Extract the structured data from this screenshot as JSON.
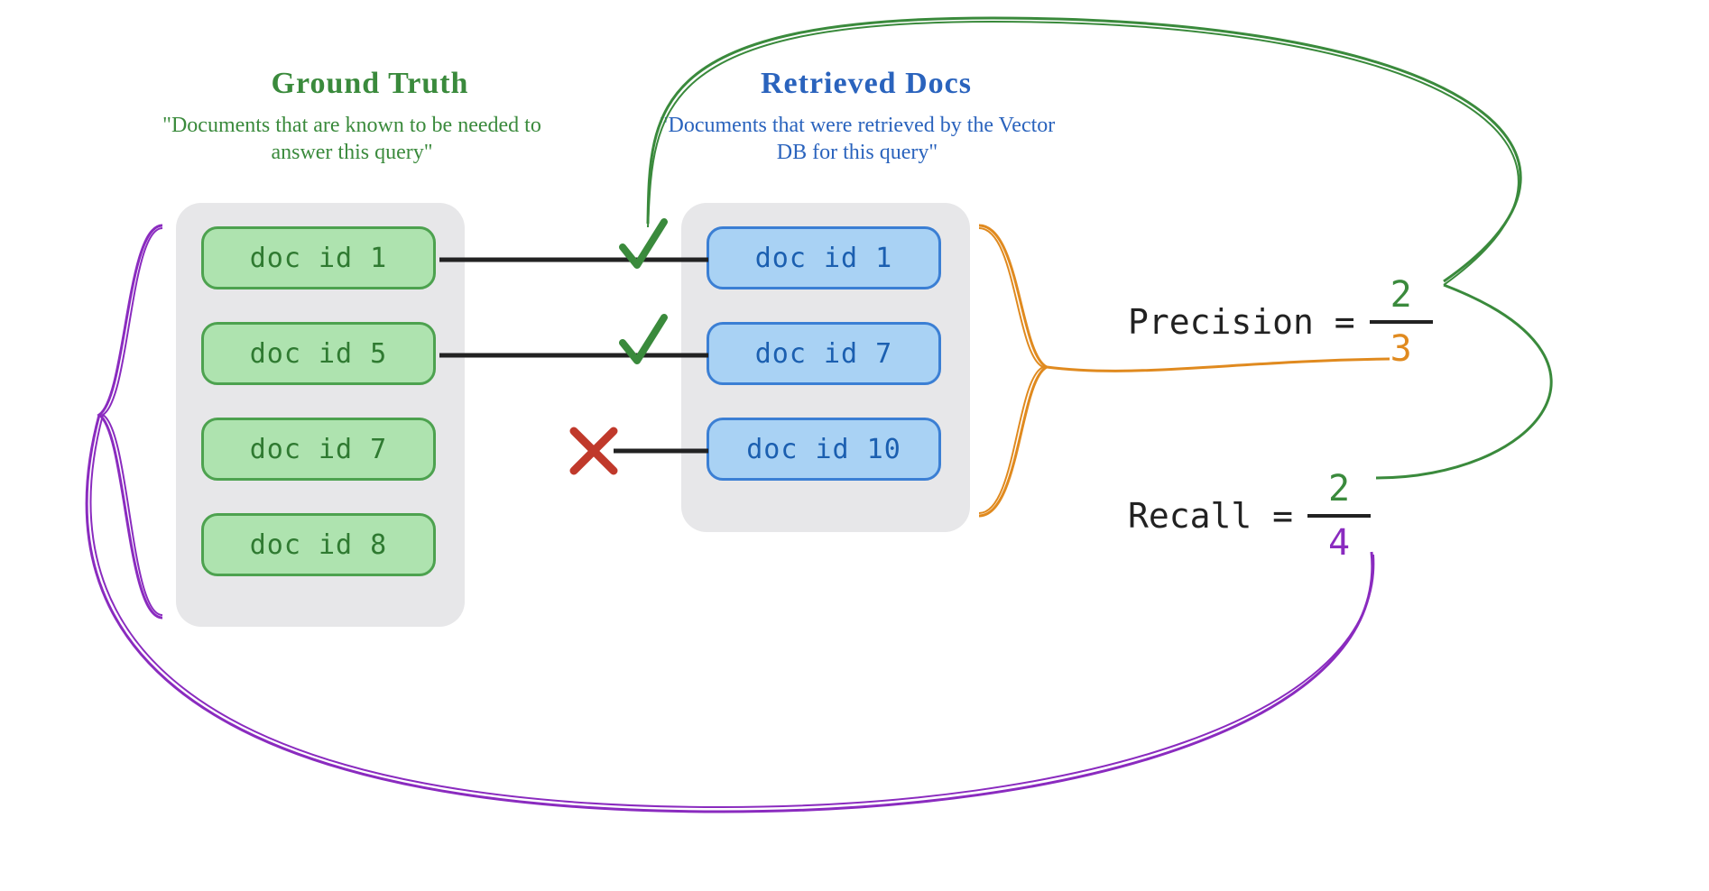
{
  "groundTruth": {
    "heading": "Ground Truth",
    "sub": "\"Documents that are known to be needed to answer this query\"",
    "docs": [
      "doc id 1",
      "doc id 5",
      "doc id 7",
      "doc id 8"
    ]
  },
  "retrieved": {
    "heading": "Retrieved Docs",
    "sub": "\"Documents that were retrieved by the Vector DB for this query\"",
    "docs": [
      "doc id 1",
      "doc id 7",
      "doc id 10"
    ]
  },
  "matches": [
    {
      "status": "hit",
      "glyph": "✓"
    },
    {
      "status": "hit",
      "glyph": "✓"
    },
    {
      "status": "miss",
      "glyph": "✕"
    }
  ],
  "formulas": {
    "precision": {
      "label": "Precision =",
      "num": "2",
      "den": "3"
    },
    "recall": {
      "label": "Recall =",
      "num": "2",
      "den": "4"
    }
  },
  "colors": {
    "greenText": "#3a8a3c",
    "blueText": "#2a63bd",
    "orange": "#e08a1f",
    "purple": "#8a2bbf",
    "redX": "#c0392b",
    "greenTick": "#3a8a3c"
  }
}
